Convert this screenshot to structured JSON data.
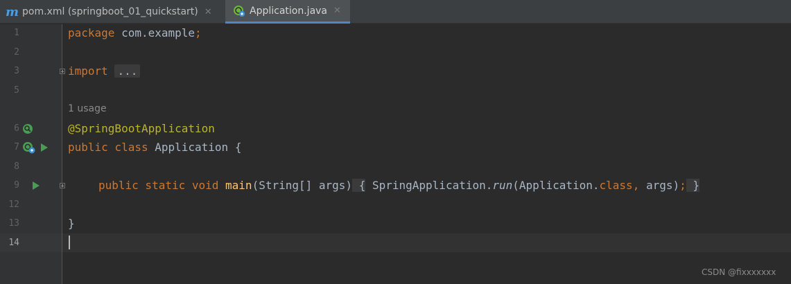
{
  "tabs": [
    {
      "icon": "maven-icon",
      "label": "pom.xml (springboot_01_quickstart)",
      "active": false
    },
    {
      "icon": "spring-boot-icon",
      "label": "Application.java",
      "active": true
    }
  ],
  "close_glyph": "✕",
  "line_numbers": [
    "1",
    "2",
    "3",
    "5",
    "6",
    "7",
    "8",
    "9",
    "12",
    "13",
    "14"
  ],
  "code": {
    "l1_kw": "package",
    "l1_rest": " com.example",
    "l1_semi": ";",
    "l3_kw": "import",
    "l3_fold": "...",
    "usage": "1 usage",
    "l6_ann": "@SpringBootApplication",
    "l7_kw": "public class",
    "l7_rest": " Application {",
    "l9_kw": "public static void",
    "l9_fn": "main",
    "l9_params": "(String[] args)",
    "l9_open": "{",
    "l9_call": " SpringApplication.",
    "l9_run": "run",
    "l9_arg1": "(Application.",
    "l9_class": "class",
    "l9_comma": ",",
    "l9_args": " args)",
    "l9_semi": ";",
    "l9_close": "}",
    "l13": "}"
  },
  "watermark": "CSDN @fixxxxxxx",
  "colors": {
    "background": "#2b2b2b",
    "keyword": "#cc7832",
    "annotation": "#bbb529",
    "method": "#ffc66d",
    "text": "#a9b7c6",
    "run": "#499c54",
    "tab_accent": "#4a88c7"
  }
}
